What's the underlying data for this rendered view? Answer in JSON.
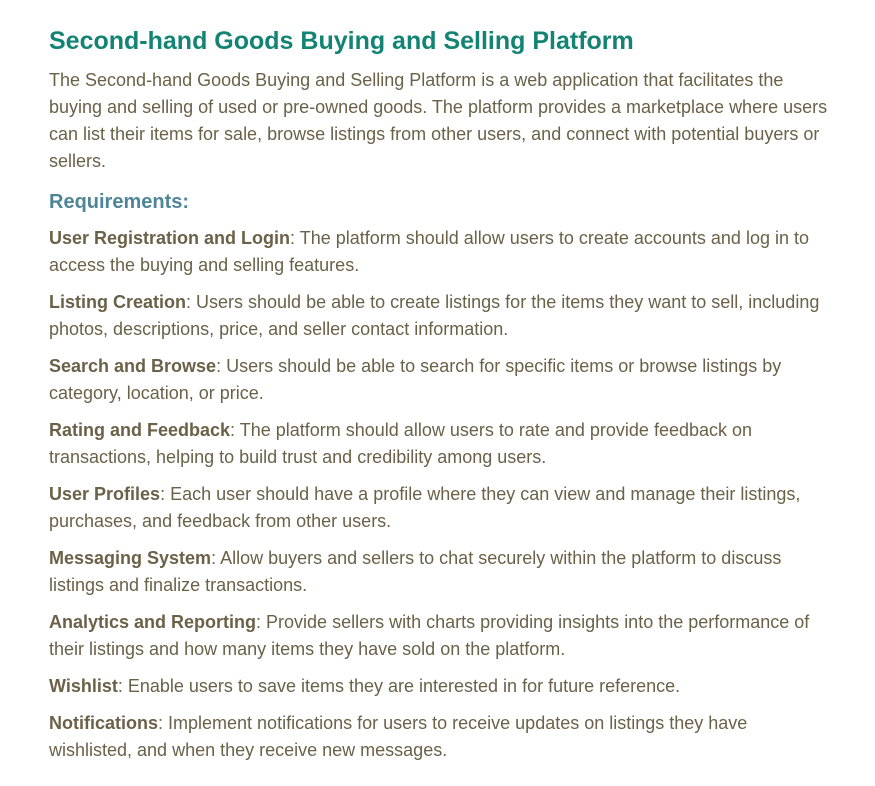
{
  "document": {
    "title": "Second-hand Goods Buying and Selling Platform",
    "intro": "The Second-hand Goods Buying and Selling Platform is a web application that facilitates the buying and selling of used or pre-owned goods. The platform provides a marketplace where users can list their items for sale, browse listings from other users, and connect with potential buyers or sellers.",
    "requirements_heading": "Requirements:",
    "requirements": [
      {
        "name": "User Registration and Login",
        "description": ": The platform should allow users to create accounts and log in to access the buying and selling features."
      },
      {
        "name": "Listing Creation",
        "description": ": Users should be able to create listings for the items they want to sell, including photos, descriptions, price, and seller contact information."
      },
      {
        "name": "Search and Browse",
        "description": ": Users should be able to search for specific items or browse listings by category, location, or price."
      },
      {
        "name": "Rating and Feedback",
        "description": ": The platform should allow users to rate and provide feedback on transactions, helping to build trust and credibility among users."
      },
      {
        "name": "User Profiles",
        "description": ": Each user should have a profile where they can view and manage their listings, purchases, and feedback from other users."
      },
      {
        "name": "Messaging System",
        "description": ": Allow buyers and sellers to chat securely within the platform to discuss listings and finalize transactions."
      },
      {
        "name": "Analytics and Reporting",
        "description": ": Provide sellers with charts providing insights into the performance of their listings and how many items they have sold on the platform."
      },
      {
        "name": "Wishlist",
        "description": ": Enable users to save items they are interested in for future reference."
      },
      {
        "name": "Notifications",
        "description": ": Implement notifications for users to receive updates on listings they have wishlisted, and when they receive new messages."
      }
    ]
  },
  "colors": {
    "title": "#138473",
    "heading": "#4e8597",
    "body_text": "#6b6148",
    "background": "#ffffff"
  }
}
